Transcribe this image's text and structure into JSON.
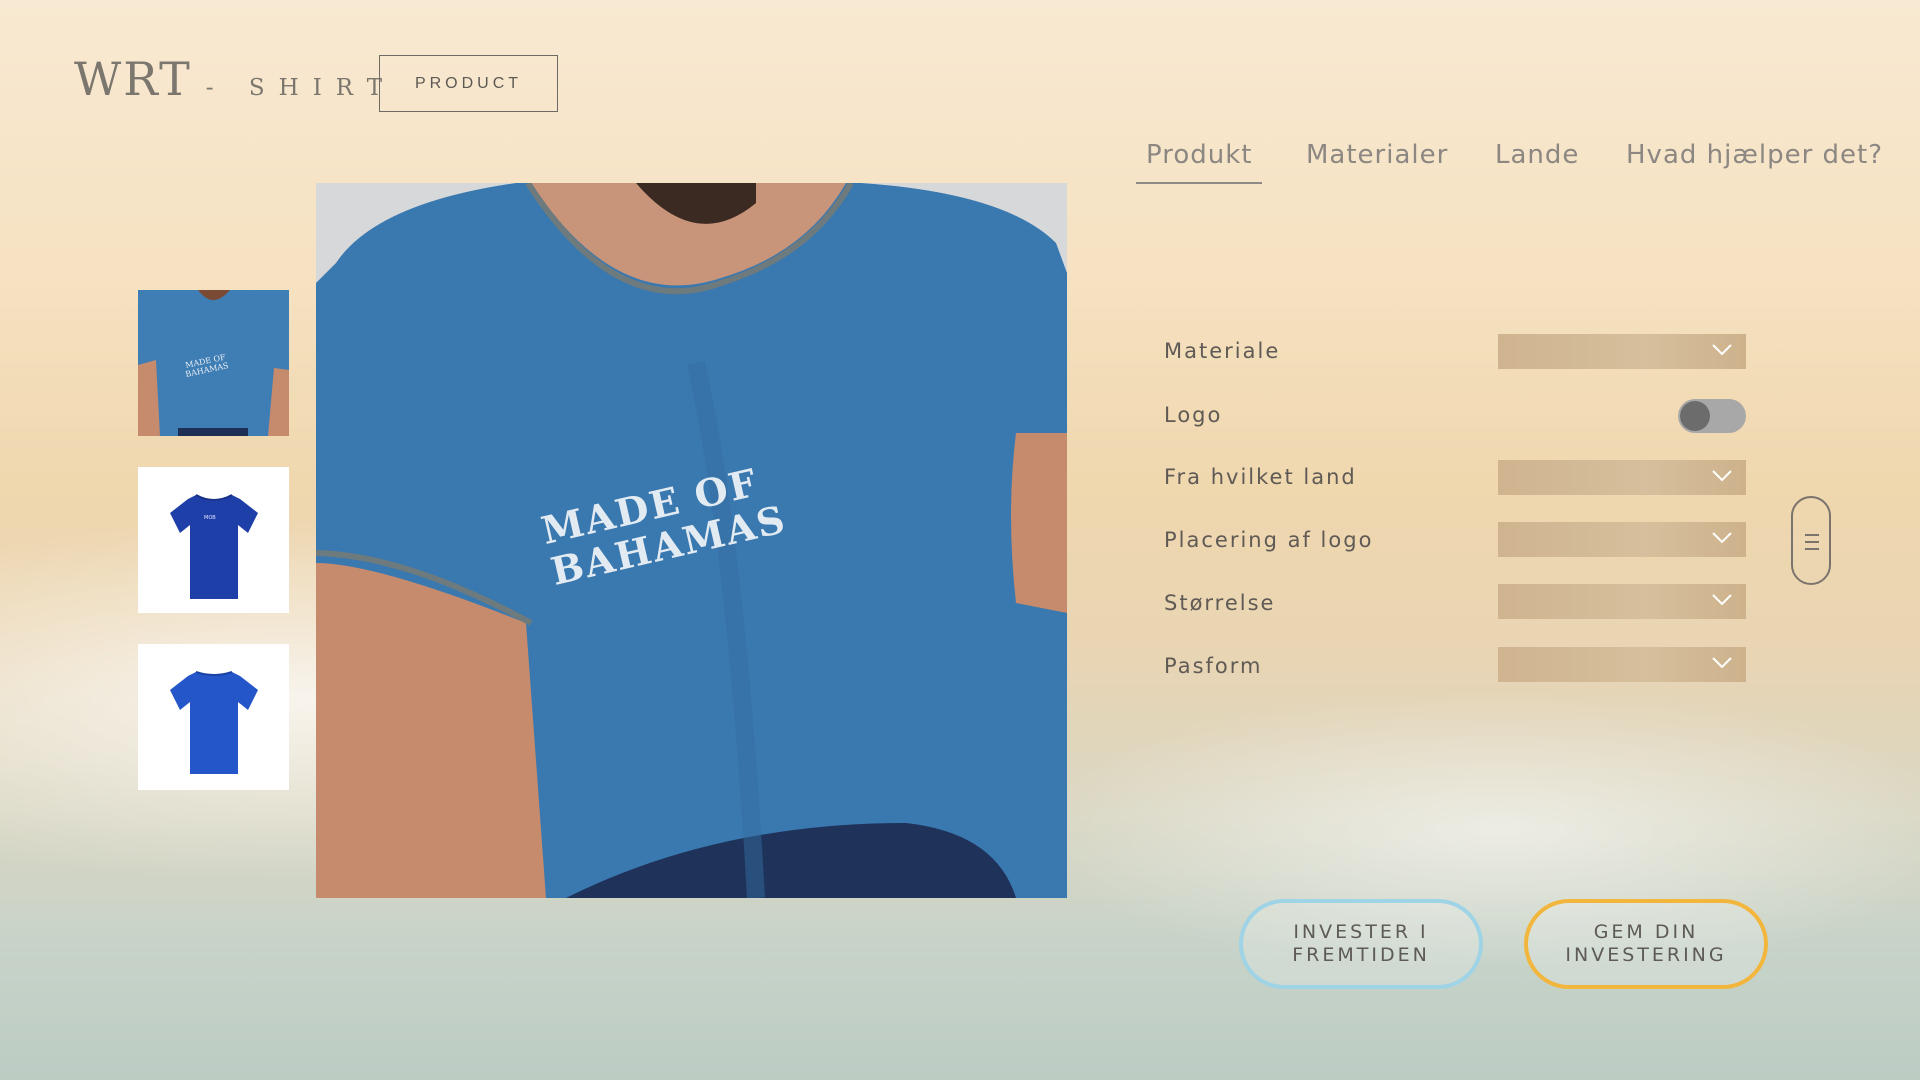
{
  "brand": {
    "main": "WRT",
    "separator": "-",
    "sub": "SHIRT"
  },
  "header": {
    "product_button": "PRODUCT"
  },
  "nav": {
    "tabs": [
      "Produkt",
      "Materialer",
      "Lande",
      "Hvad hjælper det?"
    ],
    "active_index": 0
  },
  "product": {
    "print_text_line1": "MADE OF",
    "print_text_line2": "BAHAMAS"
  },
  "options": {
    "material": {
      "label": "Materiale",
      "value": ""
    },
    "logo": {
      "label": "Logo",
      "on": false
    },
    "country": {
      "label": "Fra hvilket land",
      "value": ""
    },
    "logo_placement": {
      "label": "Placering af logo",
      "value": ""
    },
    "size": {
      "label": "Størrelse",
      "value": ""
    },
    "fit": {
      "label": "Pasform",
      "value": ""
    }
  },
  "actions": {
    "invest": {
      "line1": "INVESTER I",
      "line2": "FREMTIDEN"
    },
    "save": {
      "line1": "GEM DIN",
      "line2": "INVESTERING"
    }
  },
  "colors": {
    "shirt_blue": "#3a78b0",
    "invest_border": "#9fd3e6",
    "save_border": "#f2b63c",
    "dropdown_fill": "#d2b995"
  },
  "icons": {
    "dropdown": "chevron-down-icon",
    "scroll": "scroll-handle-icon"
  }
}
